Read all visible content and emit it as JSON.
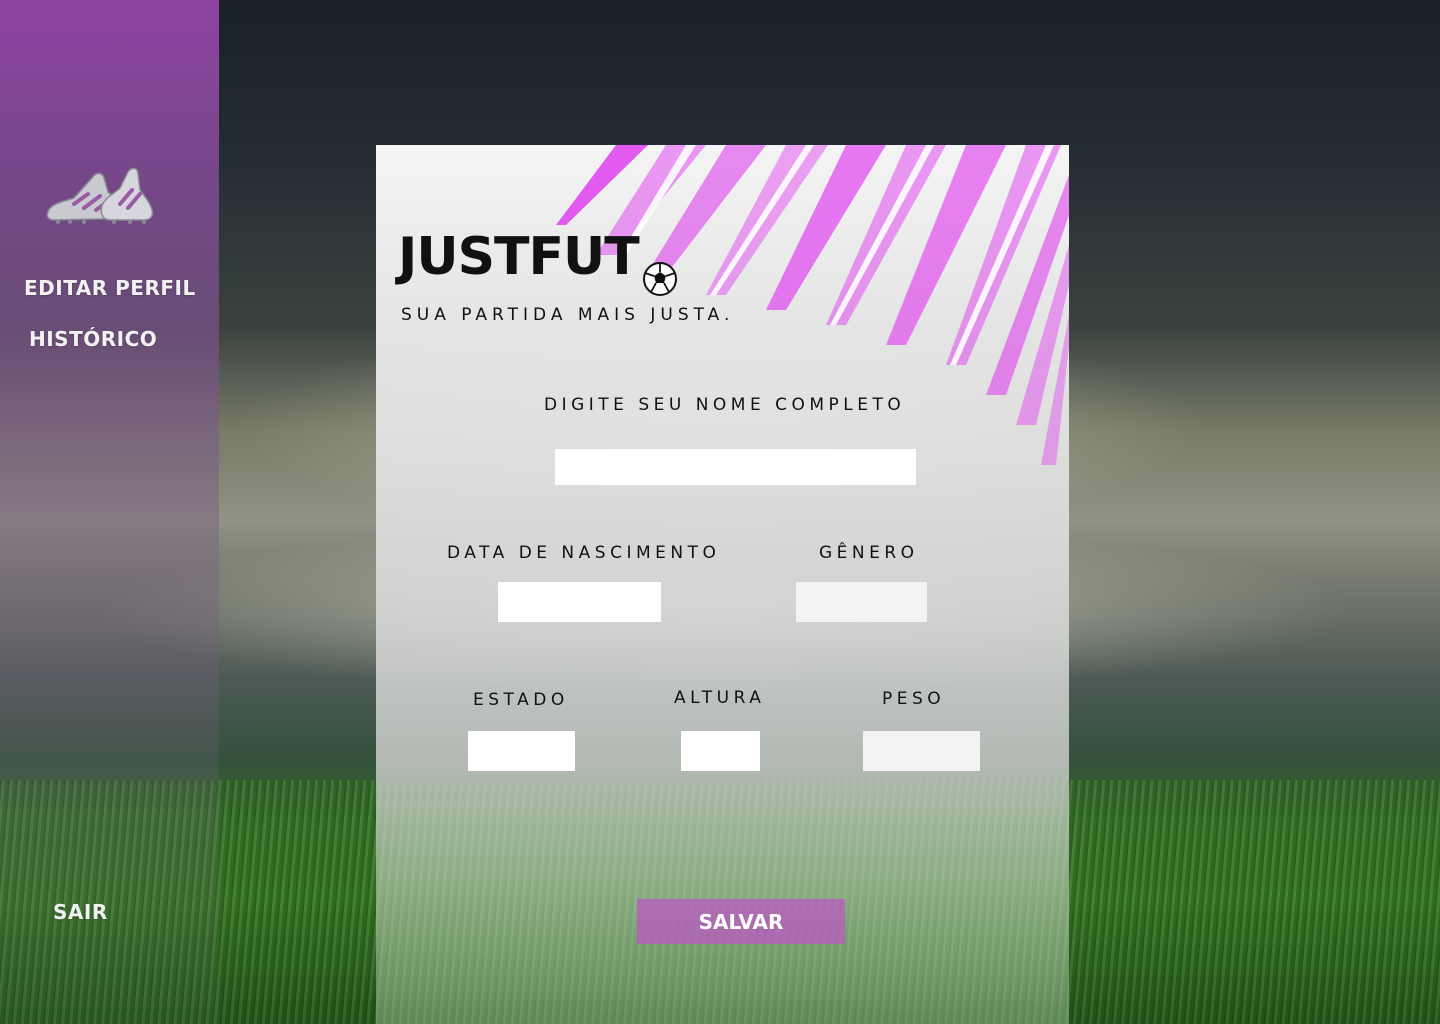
{
  "sidebar": {
    "logo_icon": "football-boots-icon",
    "items": [
      {
        "label": "EDITAR PERFIL"
      },
      {
        "label": "HISTÓRICO"
      }
    ],
    "exit_label": "SAIR"
  },
  "brand": {
    "name": "JUSTFUT",
    "icon": "soccer-ball-icon",
    "tagline": "SUA PARTIDA MAIS JUSTA."
  },
  "form": {
    "full_name": {
      "label": "DIGITE SEU NOME COMPLETO",
      "value": ""
    },
    "birth_date": {
      "label": "DATA DE NASCIMENTO",
      "value": ""
    },
    "gender": {
      "label": "GÊNERO",
      "value": ""
    },
    "state": {
      "label": "ESTADO",
      "value": ""
    },
    "height": {
      "label": "ALTURA",
      "value": ""
    },
    "weight": {
      "label": "PESO",
      "value": ""
    },
    "save_label": "SALVAR"
  },
  "colors": {
    "accent": "#b95ac3",
    "stripe": "#e040f0",
    "sidebar_top": "#9646aa"
  }
}
